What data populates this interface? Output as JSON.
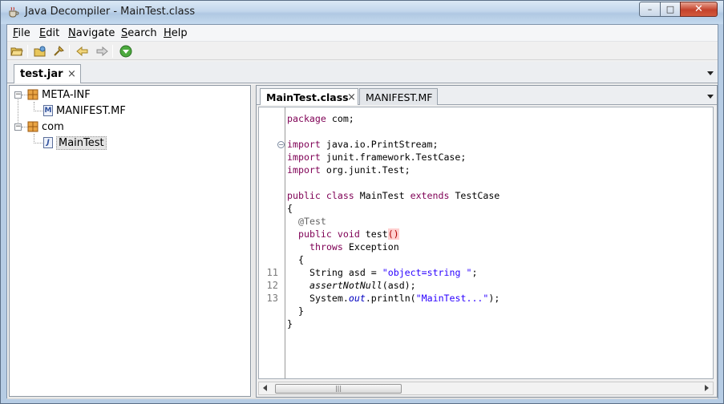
{
  "window": {
    "title": "Java Decompiler - MainTest.class",
    "controls": {
      "minimize": "–",
      "maximize": "□",
      "close": "✕"
    }
  },
  "menu": {
    "items": [
      {
        "label": "File",
        "mnemonic": "F",
        "rest": "ile"
      },
      {
        "label": "Edit",
        "mnemonic": "E",
        "rest": "dit"
      },
      {
        "label": "Navigate",
        "mnemonic": "N",
        "rest": "avigate"
      },
      {
        "label": "Search",
        "mnemonic": "S",
        "rest": "earch"
      },
      {
        "label": "Help",
        "mnemonic": "H",
        "rest": "elp"
      }
    ]
  },
  "toolbar": {
    "icons": [
      "open-file-icon",
      "open-type-icon",
      "search-icon",
      "back-icon",
      "forward-icon",
      "about-icon"
    ]
  },
  "jar_tabs": [
    {
      "label": "test.jar",
      "close": "×"
    }
  ],
  "tree": {
    "nodes": [
      {
        "label": "META-INF",
        "type": "package",
        "expanded": true
      },
      {
        "label": "MANIFEST.MF",
        "type": "manifest",
        "icon_letter": "M"
      },
      {
        "label": "com",
        "type": "package",
        "expanded": true
      },
      {
        "label": "MainTest",
        "type": "class",
        "icon_letter": "J",
        "selected": true
      }
    ]
  },
  "editor": {
    "tabs": [
      {
        "label": "MainTest.class",
        "close": "×",
        "active": true
      },
      {
        "label": "MANIFEST.MF",
        "active": false
      }
    ],
    "line_numbers": [
      "11",
      "12",
      "13"
    ],
    "fold_marker": "−",
    "scroll_thumb": "|||",
    "code": {
      "l1_kw": "package",
      "l1_rest": " com;",
      "l3_kw": "import",
      "l3_rest": " java.io.PrintStream;",
      "l4_kw": "import",
      "l4_rest": " junit.framework.TestCase;",
      "l5_kw": "import",
      "l5_rest": " org.junit.Test;",
      "l7_kw1": "public",
      "l7_kw2": "class",
      "l7_name": " MainTest ",
      "l7_kw3": "extends",
      "l7_rest": " TestCase",
      "l8": "{",
      "l9_ann": "@Test",
      "l10_kw1": "public",
      "l10_kw2": "void",
      "l10_name": " test",
      "l10_paren": "()",
      "l11_kw": "throws",
      "l11_rest": " Exception",
      "l12": "{",
      "l13_pre": "String asd = ",
      "l13_str": "\"object=string \"",
      "l13_post": ";",
      "l14_it": "assertNotNull",
      "l14_rest": "(asd);",
      "l15_pre": "System.",
      "l15_it": "out",
      "l15_mid": ".println(",
      "l15_str": "\"MainTest...\"",
      "l15_post": ");",
      "l16": "}",
      "l17": "}"
    }
  },
  "colors": {
    "keyword": "#7f0055",
    "string": "#2a00ff",
    "annotation": "#646464"
  }
}
